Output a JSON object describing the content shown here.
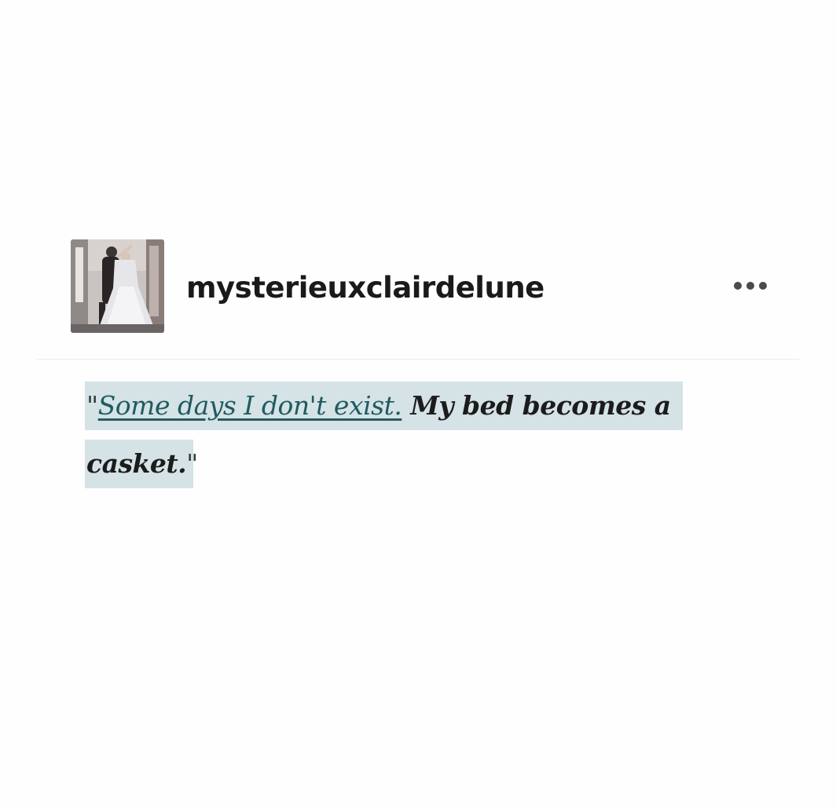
{
  "post": {
    "username": "mysterieuxclairdelune",
    "avatar_icon": "avatar-photo",
    "more_icon": "ellipsis-icon"
  },
  "quote": {
    "open_mark": "\"",
    "linked_text": "Some days I don't exist.",
    "line1_rest": " My bed becomes a",
    "line2_text": "casket.",
    "close_mark": "\"",
    "highlight_color": "#d5e2e6",
    "link_color": "#1f5b60"
  }
}
